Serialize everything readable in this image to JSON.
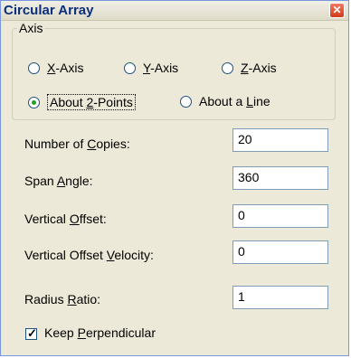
{
  "window": {
    "title": "Circular Array",
    "close_glyph": "✕"
  },
  "axis_group": {
    "legend": "Axis",
    "options": [
      {
        "pre": "",
        "mnemonic": "X",
        "post": "-Axis",
        "checked": false
      },
      {
        "pre": "",
        "mnemonic": "Y",
        "post": "-Axis",
        "checked": false
      },
      {
        "pre": "",
        "mnemonic": "Z",
        "post": "-Axis",
        "checked": false
      },
      {
        "pre": "About ",
        "mnemonic": "2",
        "post": "-Points",
        "checked": true
      },
      {
        "pre": "About a ",
        "mnemonic": "L",
        "post": "ine",
        "checked": false
      }
    ]
  },
  "fields": [
    {
      "pre": "Number of ",
      "mnemonic": "C",
      "post": "opies:",
      "value": "20"
    },
    {
      "pre": "Span ",
      "mnemonic": "A",
      "post": "ngle:",
      "value": "360"
    },
    {
      "pre": "Vertical ",
      "mnemonic": "O",
      "post": "ffset:",
      "value": "0"
    },
    {
      "pre": "Vertical Offset ",
      "mnemonic": "V",
      "post": "elocity:",
      "value": "0"
    },
    {
      "pre": "Radius ",
      "mnemonic": "R",
      "post": "atio:",
      "value": "1"
    }
  ],
  "keep_perpendicular": {
    "pre": "Keep ",
    "mnemonic": "P",
    "post": "erpendicular",
    "checked": true
  }
}
